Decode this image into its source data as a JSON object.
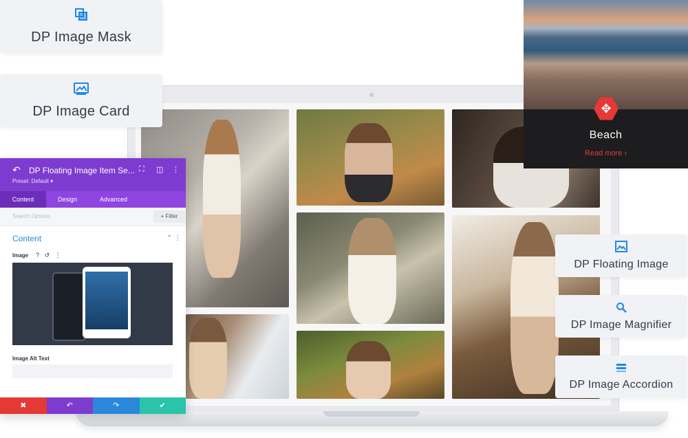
{
  "cards": {
    "mask": "DP Image Mask",
    "card": "DP Image Card",
    "floating": "DP Floating Image",
    "magnifier": "DP Image Magnifier",
    "accordion": "DP Image Accordion"
  },
  "beach": {
    "title": "Beach",
    "link": "Read more"
  },
  "panel": {
    "title": "DP Floating Image Item Se...",
    "preset": "Preset: Default",
    "tabs": [
      "Content",
      "Design",
      "Advanced"
    ],
    "search_placeholder": "Search Options",
    "filter_label": "+ Filter",
    "section_title": "Content",
    "image_label": "Image",
    "alt_label": "Image Alt Text"
  },
  "colors": {
    "accent_purple": "#7e3bd0",
    "accent_blue": "#1e88e5",
    "danger_red": "#e53935",
    "save_green": "#29c4a9"
  }
}
